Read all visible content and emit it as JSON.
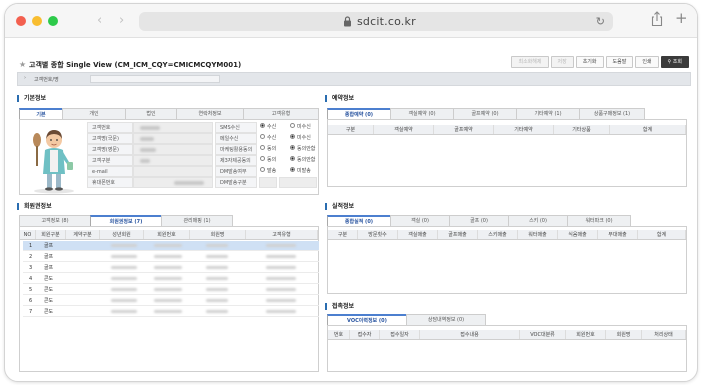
{
  "browser": {
    "url": "sdcit.co.kr",
    "back_icon": "chevron-left-icon",
    "forward_icon": "chevron-right-icon"
  },
  "header": {
    "title": "고객별 종합 Single View (CM_ICM_CQY=CMICMCQYM001)",
    "buttons": [
      {
        "label": "최소화해제",
        "state": "disabled"
      },
      {
        "label": "저장",
        "state": "disabled"
      },
      {
        "label": "초기화",
        "state": "normal"
      },
      {
        "label": "도움말",
        "state": "normal"
      },
      {
        "label": "인쇄",
        "state": "normal"
      },
      {
        "label": "조회",
        "state": "primary"
      }
    ]
  },
  "search": {
    "label": "고객번호/명"
  },
  "basic_info": {
    "title": "기본정보",
    "tabs": [
      "기본",
      "개인",
      "법인",
      "연락처정보",
      "고객유형"
    ],
    "active_tab": 0,
    "fields_left": [
      "고객번호",
      "고객명(국문)",
      "고객명(영문)",
      "고객구분",
      "e-mail",
      "휴대폰번호"
    ],
    "fields_right": [
      {
        "label": "SMS수신",
        "opt1": "수신",
        "opt2": "미수신",
        "selected": 1
      },
      {
        "label": "메일수신",
        "opt1": "수신",
        "opt2": "미수신",
        "selected": 2
      },
      {
        "label": "마케팅활용동의",
        "opt1": "동의",
        "opt2": "동의안함",
        "selected": 2
      },
      {
        "label": "제3자제공동의",
        "opt1": "동의",
        "opt2": "동의안함",
        "selected": 2
      },
      {
        "label": "DM발송여부",
        "opt1": "발송",
        "opt2": "미발송",
        "selected": 2
      },
      {
        "label": "DM발송구분",
        "opt1": "",
        "opt2": "",
        "selected": 0
      }
    ]
  },
  "member_info": {
    "title": "회원권정보",
    "tabs": [
      "고객정보 (8)",
      "회원권정보 (7)",
      "관리매핑 (1)"
    ],
    "active_tab": 1,
    "columns": [
      "NO",
      "회원구분",
      "계약구분",
      "성년회원",
      "회원번호",
      "회원명",
      "고객유형"
    ],
    "rows": [
      {
        "no": "1",
        "type": "골프"
      },
      {
        "no": "2",
        "type": "골프"
      },
      {
        "no": "3",
        "type": "골프"
      },
      {
        "no": "4",
        "type": "콘도"
      },
      {
        "no": "5",
        "type": "콘도"
      },
      {
        "no": "6",
        "type": "콘도"
      },
      {
        "no": "7",
        "type": "콘도"
      }
    ]
  },
  "reservation_info": {
    "title": "예약정보",
    "tabs": [
      "종합예약 (0)",
      "객실예약 (0)",
      "골프예약 (0)",
      "기타예약 (1)",
      "상품구매정보 (1)"
    ],
    "active_tab": 0,
    "columns": [
      "구분",
      "객실예약",
      "골프예약",
      "기타예약",
      "기타상품",
      "합계"
    ]
  },
  "performance_info": {
    "title": "실적정보",
    "tabs": [
      "종합실적 (0)",
      "객실 (0)",
      "골프 (0)",
      "스키 (0)",
      "워터파크 (0)"
    ],
    "active_tab": 0,
    "columns": [
      "구분",
      "방문횟수",
      "객실매출",
      "골프매출",
      "스키매출",
      "워터매출",
      "식음매출",
      "부대매출",
      "합계"
    ]
  },
  "contact_info": {
    "title": "접촉정보",
    "tabs": [
      "VOC이력정보 (0)",
      "상담내역정보 (0)"
    ],
    "active_tab": 0,
    "columns": [
      "번호",
      "접수자",
      "접수일자",
      "접수내용",
      "VOC대분류",
      "회원번호",
      "회원명",
      "처리상태"
    ]
  }
}
